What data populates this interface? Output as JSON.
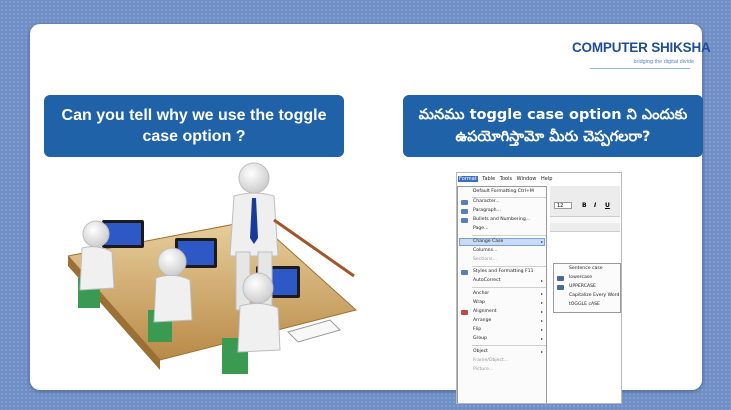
{
  "logo": {
    "name": "COMPUTER SHIKSHA",
    "tagline": "bridging the digital divide"
  },
  "question_en": "Can you tell why we use the toggle case option ?",
  "question_te": "మనము toggle case option ని ఎందుకు ఉపయోగిస్తామో మీరు చెప్పగలరా?",
  "menu_bar": [
    "Format",
    "Table",
    "Tools",
    "Window",
    "Help"
  ],
  "format_menu": [
    "Default Formatting Ctrl+M",
    "Character...",
    "Paragraph...",
    "Bullets and Numbering...",
    "Page...",
    "Change Case",
    "Columns...",
    "Sections...",
    "Styles and Formatting F11",
    "AutoCorrect",
    "Anchor",
    "Wrap",
    "Alignment",
    "Arrange",
    "Flip",
    "Group",
    "Object",
    "Frame/Object...",
    "Picture..."
  ],
  "change_case_submenu": [
    "Sentence case",
    "lowercase",
    "UPPERCASE",
    "Capitalize Every Word",
    "tOGGLE cASE"
  ],
  "toolbar": {
    "font_size": "12",
    "bold": "B",
    "italic": "I",
    "underline": "U"
  },
  "colors": {
    "accent": "#1f62a8",
    "background": "#6f8fc6",
    "logo": "#1f4e96"
  }
}
